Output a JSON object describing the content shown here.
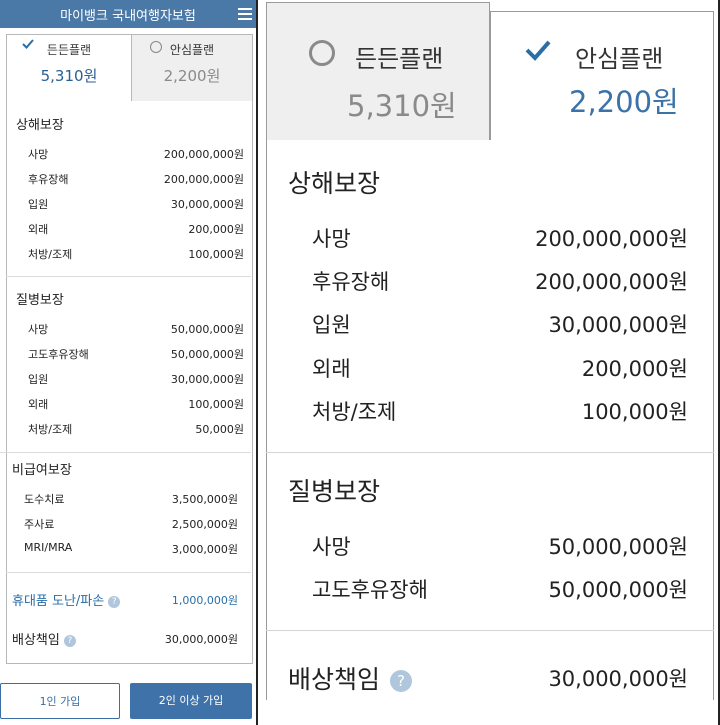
{
  "app": {
    "title": "마이뱅크 국내여행자보험"
  },
  "left": {
    "plans": [
      {
        "name": "든든플랜",
        "price": "5,310원"
      },
      {
        "name": "안심플랜",
        "price": "2,200원"
      }
    ],
    "injury": {
      "title": "상해보장",
      "rows": [
        {
          "label": "사망",
          "value": "200,000,000원"
        },
        {
          "label": "후유장해",
          "value": "200,000,000원"
        },
        {
          "label": "입원",
          "value": "30,000,000원"
        },
        {
          "label": "외래",
          "value": "200,000원"
        },
        {
          "label": "처방/조제",
          "value": "100,000원"
        }
      ]
    },
    "disease": {
      "title": "질병보장",
      "rows": [
        {
          "label": "사망",
          "value": "50,000,000원"
        },
        {
          "label": "고도후유장해",
          "value": "50,000,000원"
        },
        {
          "label": "입원",
          "value": "30,000,000원"
        },
        {
          "label": "외래",
          "value": "100,000원"
        },
        {
          "label": "처방/조제",
          "value": "50,000원"
        }
      ]
    },
    "noncovered": {
      "title": "비급여보장",
      "rows": [
        {
          "label": "도수치료",
          "value": "3,500,000원"
        },
        {
          "label": "주사료",
          "value": "2,500,000원"
        },
        {
          "label": "MRI/MRA",
          "value": "3,000,000원"
        }
      ]
    },
    "phone": {
      "label": "휴대품 도난/파손",
      "value": "1,000,000원"
    },
    "liability": {
      "label": "배상책임",
      "value": "30,000,000원"
    },
    "buttons": {
      "one": "1인 가입",
      "two": "2인 이상 가입"
    }
  },
  "right": {
    "plans": [
      {
        "name": "든든플랜",
        "price": "5,310원"
      },
      {
        "name": "안심플랜",
        "price": "2,200원"
      }
    ],
    "injury": {
      "title": "상해보장",
      "rows": [
        {
          "label": "사망",
          "value": "200,000,000원"
        },
        {
          "label": "후유장해",
          "value": "200,000,000원"
        },
        {
          "label": "입원",
          "value": "30,000,000원"
        },
        {
          "label": "외래",
          "value": "200,000원"
        },
        {
          "label": "처방/조제",
          "value": "100,000원"
        }
      ]
    },
    "disease": {
      "title": "질병보장",
      "rows": [
        {
          "label": "사망",
          "value": "50,000,000원"
        },
        {
          "label": "고도후유장해",
          "value": "50,000,000원"
        }
      ]
    },
    "liability": {
      "label": "배상책임",
      "value": "30,000,000원"
    }
  },
  "help_mark": "?",
  "icons": {
    "check": "check-icon",
    "radio": "radio-icon",
    "menu": "hamburger-menu-icon",
    "help": "help-icon"
  },
  "colors": {
    "header": "#4a79a8",
    "accent": "#2a6ea7",
    "inactive": "#8a8a8a"
  }
}
